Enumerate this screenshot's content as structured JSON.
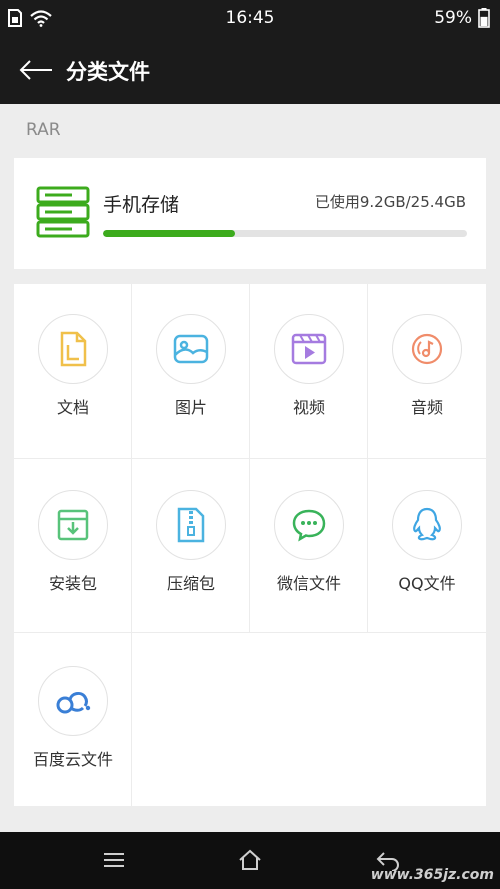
{
  "status_bar": {
    "time": "16:45",
    "battery_percent": "59%",
    "icons": [
      "sim-icon",
      "wifi-icon",
      "battery-icon"
    ]
  },
  "header": {
    "title": "分类文件",
    "back_icon": "back-arrow-icon"
  },
  "section_label": "RAR",
  "storage": {
    "name": "手机存储",
    "usage_text": "已使用9.2GB/25.4GB",
    "used_fraction": 0.362,
    "bar_color": "#3cab1d",
    "icon": "storage-server-icon"
  },
  "categories": [
    {
      "label": "文档",
      "icon": "document-icon",
      "color": "#f0c04a"
    },
    {
      "label": "图片",
      "icon": "image-icon",
      "color": "#4bb3e0"
    },
    {
      "label": "视频",
      "icon": "video-icon",
      "color": "#a57be0"
    },
    {
      "label": "音频",
      "icon": "music-icon",
      "color": "#f08c6a"
    },
    {
      "label": "安装包",
      "icon": "package-icon",
      "color": "#58c37a"
    },
    {
      "label": "压缩包",
      "icon": "zip-icon",
      "color": "#4bb3e0"
    },
    {
      "label": "微信文件",
      "icon": "wechat-icon",
      "color": "#39b35a"
    },
    {
      "label": "QQ文件",
      "icon": "qq-icon",
      "color": "#3fa6e3"
    },
    {
      "label": "百度云文件",
      "icon": "baidu-cloud-icon",
      "color": "#3a7fd6"
    }
  ],
  "nav_bar": {
    "icons": [
      "menu-icon",
      "home-icon",
      "back-icon"
    ]
  },
  "watermark": "www.365jz.com"
}
